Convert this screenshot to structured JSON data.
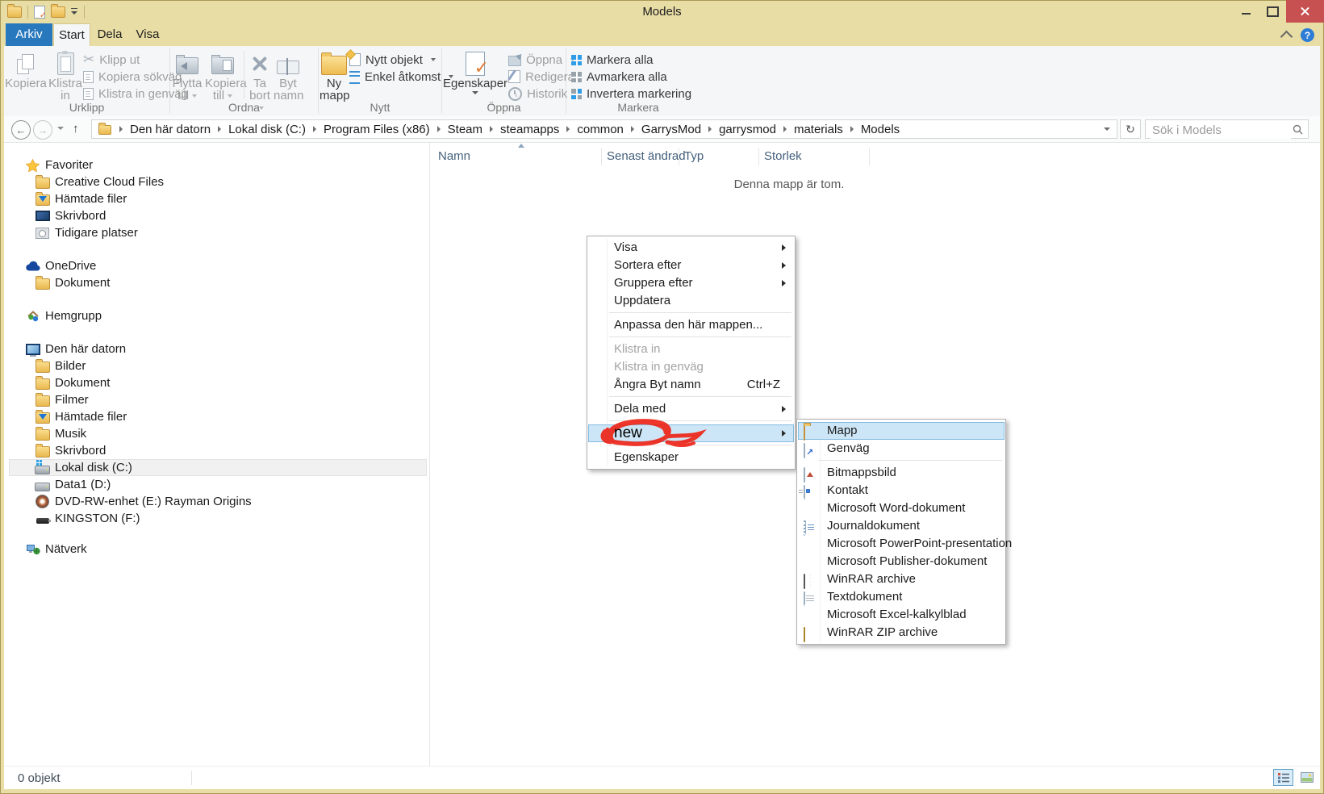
{
  "window": {
    "title": "Models",
    "qat_icons": [
      "explorer-folder-icon",
      "properties-icon",
      "new-folder-icon",
      "customize-qat-icon"
    ]
  },
  "tabs": {
    "file": "Arkiv",
    "items": [
      "Start",
      "Dela",
      "Visa"
    ],
    "active": "Start"
  },
  "ribbon": {
    "groups": [
      {
        "label": "Urklipp",
        "big": [
          {
            "label": "Kopiera"
          },
          {
            "label": "Klistra in"
          }
        ],
        "small": [
          {
            "label": "Klipp ut"
          },
          {
            "label": "Kopiera sökväg"
          },
          {
            "label": "Klistra in genväg"
          }
        ]
      },
      {
        "label": "Ordna",
        "big": [
          {
            "label": "Flytta till"
          },
          {
            "label": "Kopiera till"
          },
          {
            "label": "Ta bort"
          },
          {
            "label": "Byt namn"
          }
        ],
        "small": []
      },
      {
        "label": "Nytt",
        "big": [
          {
            "label": "Ny mapp"
          }
        ],
        "small": [
          {
            "label": "Nytt objekt"
          },
          {
            "label": "Enkel åtkomst"
          }
        ]
      },
      {
        "label": "Öppna",
        "big": [
          {
            "label": "Egenskaper"
          }
        ],
        "small": [
          {
            "label": "Öppna"
          },
          {
            "label": "Redigera"
          },
          {
            "label": "Historik"
          }
        ]
      },
      {
        "label": "Markera",
        "big": [],
        "small": [
          {
            "label": "Markera alla"
          },
          {
            "label": "Avmarkera alla"
          },
          {
            "label": "Invertera markering"
          }
        ]
      }
    ]
  },
  "address": {
    "path": [
      "Den här datorn",
      "Lokal disk (C:)",
      "Program Files (x86)",
      "Steam",
      "steamapps",
      "common",
      "GarrysMod",
      "garrysmod",
      "materials",
      "Models"
    ],
    "search_placeholder": "Sök i Models"
  },
  "sidebar": {
    "sections": [
      {
        "label": "Favoriter",
        "icon": "star-icon",
        "children": [
          {
            "label": "Creative Cloud Files",
            "icon": "folder-icon"
          },
          {
            "label": "Hämtade filer",
            "icon": "folder-download-icon"
          },
          {
            "label": "Skrivbord",
            "icon": "desktop-icon"
          },
          {
            "label": "Tidigare platser",
            "icon": "recent-places-icon"
          }
        ]
      },
      {
        "label": "OneDrive",
        "icon": "onedrive-cloud-icon",
        "children": [
          {
            "label": "Dokument",
            "icon": "folder-icon"
          }
        ]
      },
      {
        "label": "Hemgrupp",
        "icon": "homegroup-icon",
        "children": []
      },
      {
        "label": "Den här datorn",
        "icon": "computer-icon",
        "children": [
          {
            "label": "Bilder",
            "icon": "folder-icon"
          },
          {
            "label": "Dokument",
            "icon": "folder-icon"
          },
          {
            "label": "Filmer",
            "icon": "folder-icon"
          },
          {
            "label": "Hämtade filer",
            "icon": "folder-download-icon"
          },
          {
            "label": "Musik",
            "icon": "folder-icon"
          },
          {
            "label": "Skrivbord",
            "icon": "folder-icon"
          },
          {
            "label": "Lokal disk (C:)",
            "icon": "drive-windows-icon"
          },
          {
            "label": "Data1 (D:)",
            "icon": "drive-icon"
          },
          {
            "label": "DVD-RW-enhet (E:) Rayman Origins",
            "icon": "dvd-icon"
          },
          {
            "label": "KINGSTON (F:)",
            "icon": "usb-drive-icon"
          }
        ]
      },
      {
        "label": "Nätverk",
        "icon": "network-icon",
        "children": []
      }
    ],
    "selected_item": "Lokal disk (C:)"
  },
  "files": {
    "columns": [
      "Namn",
      "Senast ändrad",
      "Typ",
      "Storlek"
    ],
    "sort_column": "Namn",
    "empty_message": "Denna mapp är tom."
  },
  "context_menu": {
    "items": [
      {
        "label": "Visa",
        "submenu": true
      },
      {
        "label": "Sortera efter",
        "submenu": true
      },
      {
        "label": "Gruppera efter",
        "submenu": true
      },
      {
        "label": "Uppdatera"
      },
      {
        "label": "Anpassa den här mappen..."
      },
      {
        "label": "Klistra in",
        "disabled": true
      },
      {
        "label": "Klistra in genväg",
        "disabled": true
      },
      {
        "label": "Ångra Byt namn",
        "shortcut": "Ctrl+Z"
      },
      {
        "label": "Dela med",
        "submenu": true
      },
      {
        "label": "new",
        "submenu": true,
        "selected": true,
        "annotated": true
      },
      {
        "label": "Egenskaper"
      }
    ]
  },
  "new_submenu": {
    "items": [
      {
        "label": "Mapp",
        "icon": "folder-icon",
        "selected": true
      },
      {
        "label": "Genväg",
        "icon": "shortcut-icon"
      },
      {
        "label": "Bitmappsbild",
        "icon": "bitmap-image-icon"
      },
      {
        "label": "Kontakt",
        "icon": "contact-icon"
      },
      {
        "label": "Microsoft Word-dokument",
        "icon": "word-icon"
      },
      {
        "label": "Journaldokument",
        "icon": "journal-icon"
      },
      {
        "label": "Microsoft PowerPoint-presentation",
        "icon": "powerpoint-icon"
      },
      {
        "label": "Microsoft Publisher-dokument",
        "icon": "publisher-icon"
      },
      {
        "label": "WinRAR archive",
        "icon": "winrar-icon"
      },
      {
        "label": "Textdokument",
        "icon": "text-document-icon"
      },
      {
        "label": "Microsoft Excel-kalkylblad",
        "icon": "excel-icon"
      },
      {
        "label": "WinRAR ZIP archive",
        "icon": "winrar-zip-icon"
      }
    ]
  },
  "status_bar": {
    "count": "0 objekt",
    "view_buttons": [
      {
        "icon": "details-view-icon",
        "selected": true
      },
      {
        "icon": "thumbnail-view-icon",
        "selected": false
      }
    ]
  },
  "annotation": {
    "text": "new",
    "color": "#ee2113"
  },
  "colors": {
    "titlebar": "#e8dda4",
    "close_button": "#c75050",
    "file_tab": "#2878be",
    "ribbon_bg": "#f5f6f7",
    "menu_highlight": "#cde6f7",
    "menu_highlight_border": "#84bce0",
    "annotation_red": "#ee2113"
  }
}
